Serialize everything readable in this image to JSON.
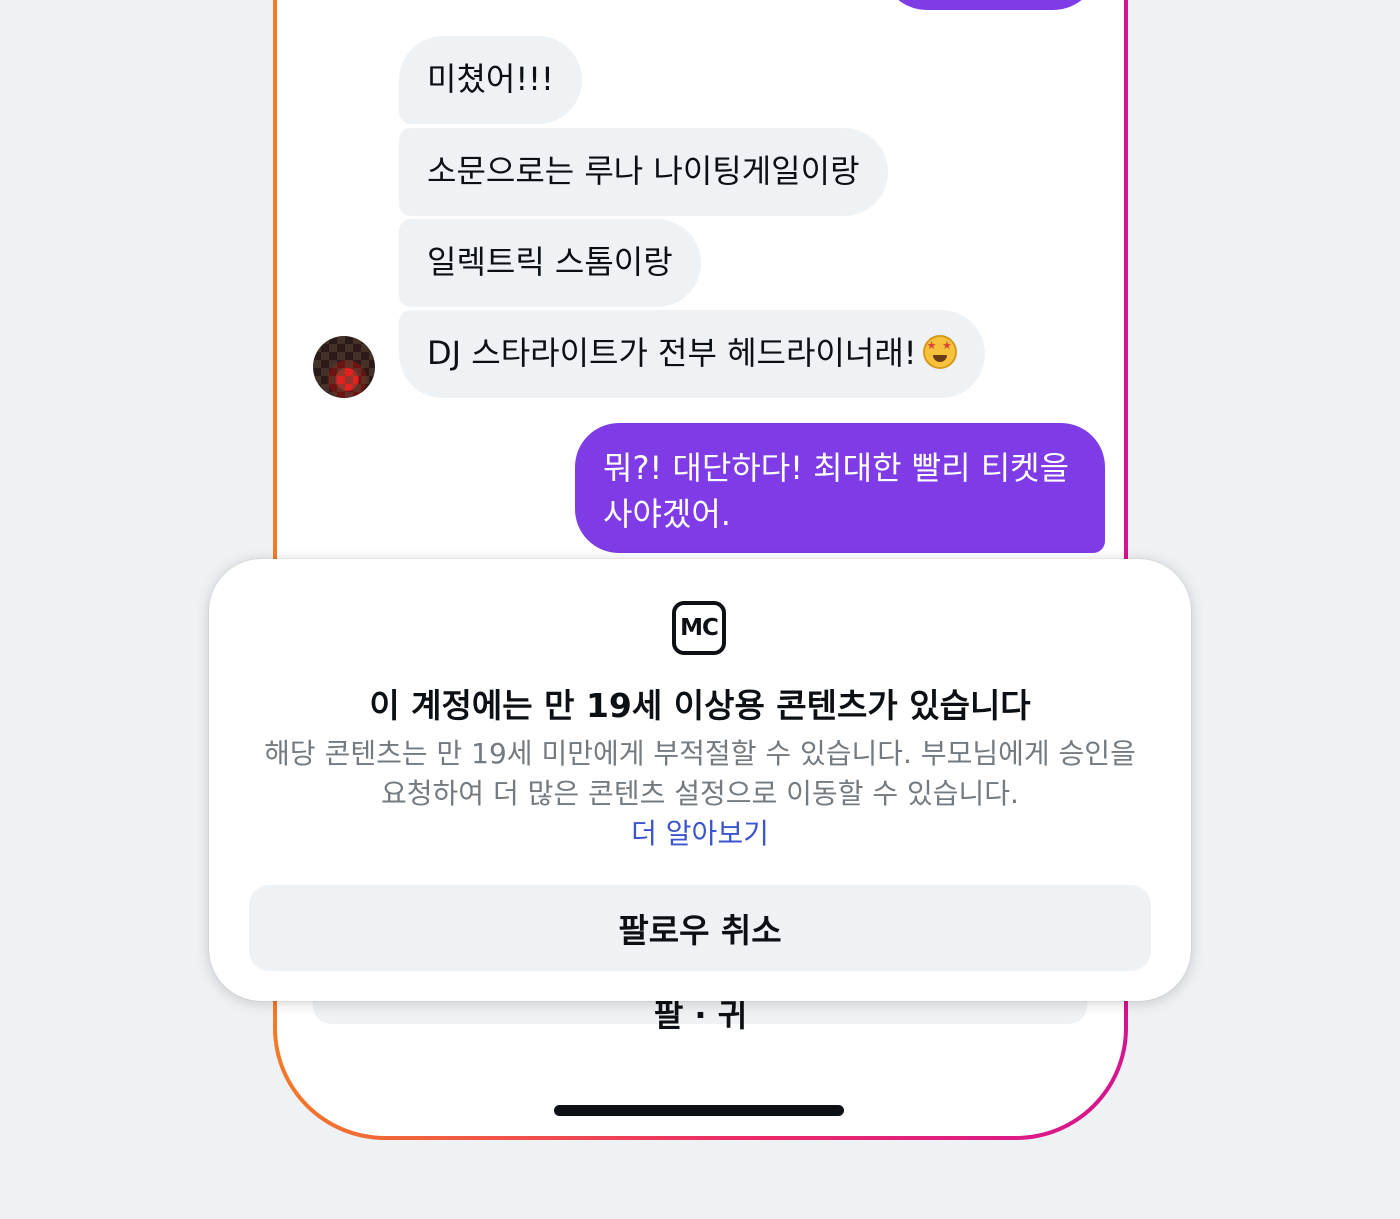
{
  "chat": {
    "received_messages": [
      "미쳤어!!!",
      "소문으로는 루나 나이팅게일이랑",
      "일렉트릭 스톰이랑",
      "DJ 스타라이트가 전부 헤드라이너래!"
    ],
    "received_emoji": "star-struck-emoji",
    "sent_message": "뭐?! 대단하다! 최대한 빨리 티켓을 사야겠어."
  },
  "underlying_sheet": {
    "button_label_fragment": "팔  ·  귀"
  },
  "modal": {
    "icon": "mc-mature-content-icon",
    "icon_text": "MC",
    "title": "이 계정에는 만 19세 이상용 콘텐츠가 있습니다",
    "description": "해당 콘텐츠는 만 19세 미만에게 부적절할 수 있습니다. 부모님에게 승인을 요청하여 더 많은 콘텐츠 설정으로 이동할 수 있습니다.",
    "learn_more": "더 알아보기",
    "unfollow_button": "팔로우 취소"
  },
  "colors": {
    "background": "#eff2f5",
    "sent_bubble": "#7f3be6",
    "received_bubble": "#eff2f5",
    "link": "#3d55cc",
    "frame_gradient": [
      "#f37a2a",
      "#ec2a67",
      "#d51590"
    ]
  }
}
